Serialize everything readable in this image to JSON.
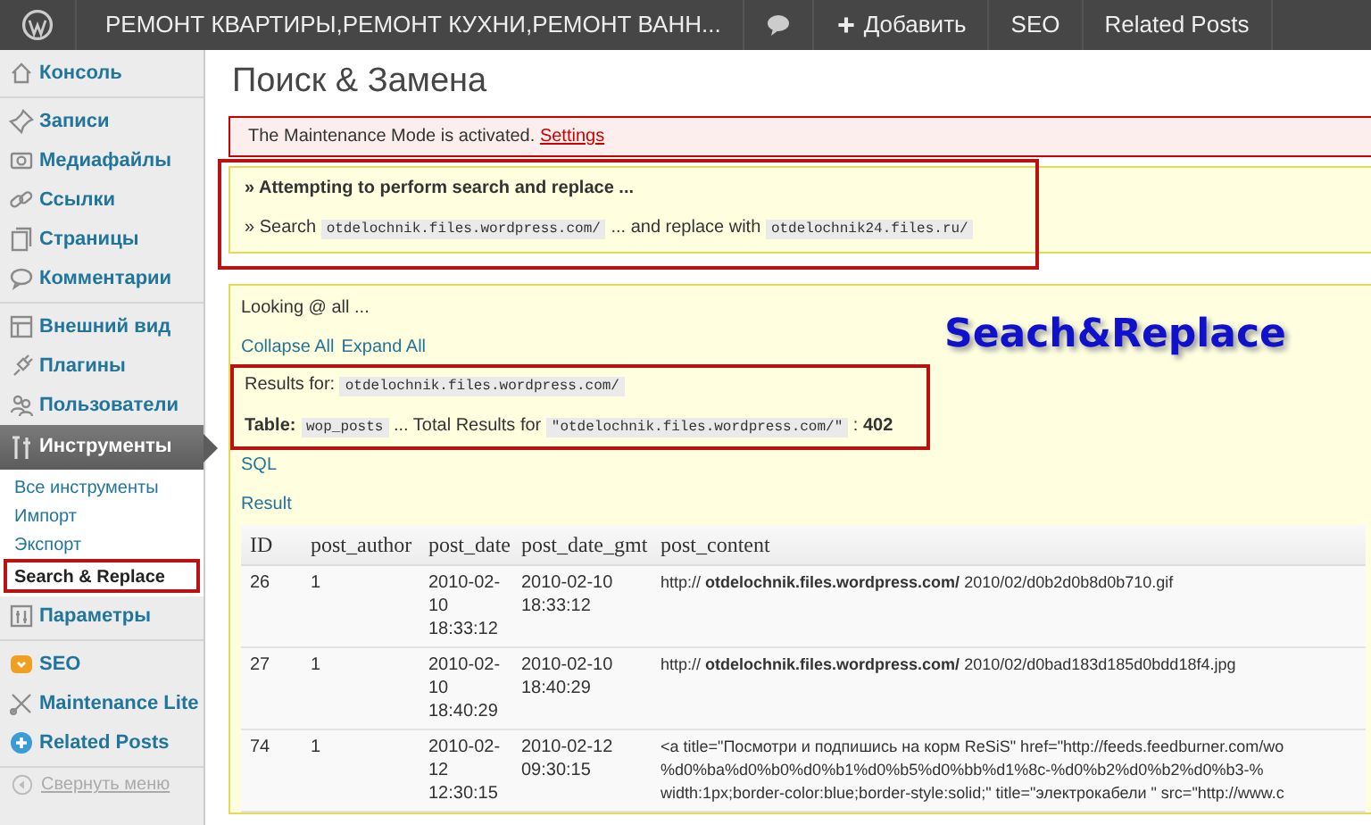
{
  "admin_bar": {
    "site_title": "РЕМОНТ КВАРТИРЫ,РЕМОНТ КУХНИ,РЕМОНТ ВАНН...",
    "add_label": "Добавить",
    "links": [
      "SEO",
      "Related Posts"
    ]
  },
  "sidebar": {
    "groups": [
      [
        {
          "label": "Консоль",
          "selected": false
        }
      ],
      [
        {
          "label": "Записи",
          "selected": false
        },
        {
          "label": "Медиафайлы",
          "selected": false
        },
        {
          "label": "Ссылки",
          "selected": false
        },
        {
          "label": "Страницы",
          "selected": false
        },
        {
          "label": "Комментарии",
          "selected": false
        }
      ],
      [
        {
          "label": "Внешний вид",
          "selected": false
        },
        {
          "label": "Плагины",
          "selected": false
        },
        {
          "label": "Пользователи",
          "selected": false
        },
        {
          "label": "Инструменты",
          "selected": true,
          "children": [
            {
              "label": "Все инструменты",
              "selected": false,
              "highlighted": false
            },
            {
              "label": "Импорт",
              "selected": false,
              "highlighted": false
            },
            {
              "label": "Экспорт",
              "selected": false,
              "highlighted": false
            },
            {
              "label": "Search & Replace",
              "selected": true,
              "highlighted": true
            }
          ]
        },
        {
          "label": "Параметры",
          "selected": false
        }
      ],
      [
        {
          "label": "SEO",
          "selected": false
        },
        {
          "label": "Maintenance Lite",
          "selected": false
        },
        {
          "label": "Related Posts",
          "selected": false
        }
      ]
    ],
    "collapse_label": "Свернуть меню"
  },
  "page_title": "Поиск & Замена",
  "notice": {
    "text": "The Maintenance Mode is activated.",
    "link": "Settings"
  },
  "attempt": {
    "highlighted": true,
    "heading": "» Attempting to perform search and replace ...",
    "search_prefix": "» Search",
    "search": "otdelochnik.files.wordpress.com/",
    "middle": "... and replace with",
    "replace": "otdelochnik24.files.ru/"
  },
  "results": {
    "looking": "Looking @ all ...",
    "links": [
      "Collapse All",
      "Expand All"
    ],
    "caption": "Seach&Replace",
    "summary": {
      "highlighted": true,
      "results_for_label": "Results for:",
      "results_for": "otdelochnik.files.wordpress.com/",
      "table_label": "Table:",
      "table_name": "wop_posts",
      "total_label": "... Total Results for",
      "total_term": "\"otdelochnik.files.wordpress.com/\"",
      "total_sep": ":",
      "total": "402"
    },
    "sql_link": "SQL",
    "result_link": "Result"
  },
  "table": {
    "columns": [
      "ID",
      "post_author",
      "post_date",
      "post_date_gmt",
      "post_content"
    ],
    "rows": [
      {
        "id": "26",
        "author": "1",
        "date": "2010-02-10 18:33:12",
        "date_gmt": "2010-02-10 18:33:12",
        "content": [
          "http:// **otdelochnik.files.wordpress.com/** 2010/02/d0b2d0b8d0b710.gif"
        ]
      },
      {
        "id": "27",
        "author": "1",
        "date": "2010-02-10 18:40:29",
        "date_gmt": "2010-02-10 18:40:29",
        "content": [
          "http:// **otdelochnik.files.wordpress.com/** 2010/02/d0bad183d185d0bdd18f4.jpg"
        ]
      },
      {
        "id": "74",
        "author": "1",
        "date": "2010-02-12 12:30:15",
        "date_gmt": "2010-02-12 09:30:15",
        "content": [
          "<a title=\"Посмотри и подпишись на корм ReSiS\" href=\"http://feeds.feedburner.com/wo",
          "%d0%ba%d0%b0%d0%b1%d0%b5%d0%bb%d1%8c-%d0%b2%d0%b2%d0%b3-%",
          "width:1px;border-color:blue;border-style:solid;\" title=\"электрокабели \" src=\"http://www.c"
        ]
      }
    ]
  }
}
